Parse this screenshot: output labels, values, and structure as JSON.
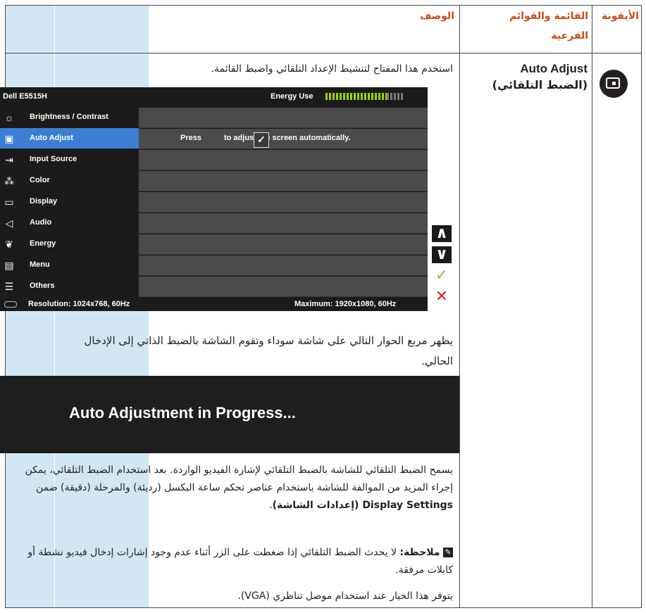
{
  "headers": {
    "icon": "الأيقونة",
    "menu": "القائمة والقوائم الفرعية",
    "description": "الوصف"
  },
  "row": {
    "menu_name_en": "Auto Adjust",
    "menu_name_ar": "(الضبط التلقائي)",
    "icon_name": "auto-adjust-icon",
    "intro": "استخدم هذا المفتاح لتنشيط الإعداد التلقائي واضبط القائمة.",
    "dialog_text": "يظهر مربع الحوار التالي على شاشة سوداء وتقوم الشاشة بالضبط الذاتي إلى الإدخال الحالي.",
    "para1_a": "يسمح الضبط التلقائي للشاشة بالضبط التلقائي لإشارة الفيديو الواردة. بعد استخدام الضبط التلقائي، يمكن إجراء المزيد من الموالفة للشاشة باستخدام عناصر تحكم ساعة البكسل (رديئة) والمرحلة (دقيقة) ضمن",
    "para1_bold": "Display Settings (إعدادات الشاشة)",
    "note_label": "ملاحظة:",
    "note_text": "لا يحدث الضبط التلقائي إذا ضغطت على الزر أثناء عدم وجود إشارات إدخال فيديو نشطة أو كابلات مرفقة.",
    "vga_text": "يتوفر هذا الخيار عند استخدام موصل تناظري (VGA)."
  },
  "osd": {
    "model": "Dell E5515H",
    "energy_label": "Energy Use",
    "energy_level": 0.78,
    "menu_items": [
      {
        "label": "Brightness / Contrast",
        "icon": "brightness-icon",
        "glyph": "☼"
      },
      {
        "label": "Auto Adjust",
        "icon": "auto-adjust-icon",
        "glyph": "▣"
      },
      {
        "label": "Input Source",
        "icon": "input-source-icon",
        "glyph": "⇥"
      },
      {
        "label": "Color",
        "icon": "color-icon",
        "glyph": "⁂"
      },
      {
        "label": "Display",
        "icon": "display-icon",
        "glyph": "▭"
      },
      {
        "label": "Audio",
        "icon": "audio-icon",
        "glyph": "◁"
      },
      {
        "label": "Energy",
        "icon": "energy-icon",
        "glyph": "❦"
      },
      {
        "label": "Menu",
        "icon": "menu-icon",
        "glyph": "▤"
      },
      {
        "label": "Others",
        "icon": "others-icon",
        "glyph": "☰"
      }
    ],
    "selected_index": 1,
    "press_text": "Press",
    "adjust_text": "to adjust the screen automatically.",
    "resolution": "Resolution: 1024x768, 60Hz",
    "maximum": "Maximum: 1920x1080, 60Hz",
    "buttons": [
      {
        "name": "up-arrow-icon",
        "glyph": "∧",
        "color": "#ffffff"
      },
      {
        "name": "down-arrow-icon",
        "glyph": "∨",
        "color": "#ffffff"
      },
      {
        "name": "check-icon",
        "glyph": "✓",
        "color": "#7dc242"
      },
      {
        "name": "close-icon",
        "glyph": "✕",
        "color": "#e02020"
      }
    ]
  },
  "auto_dialog": "Auto Adjustment in Progress...",
  "colors": {
    "header_text": "#cf4a16",
    "cell_bg": "#d1e7f5",
    "osd_selected": "#3b7fd4",
    "energy_green": "#9bd400"
  }
}
